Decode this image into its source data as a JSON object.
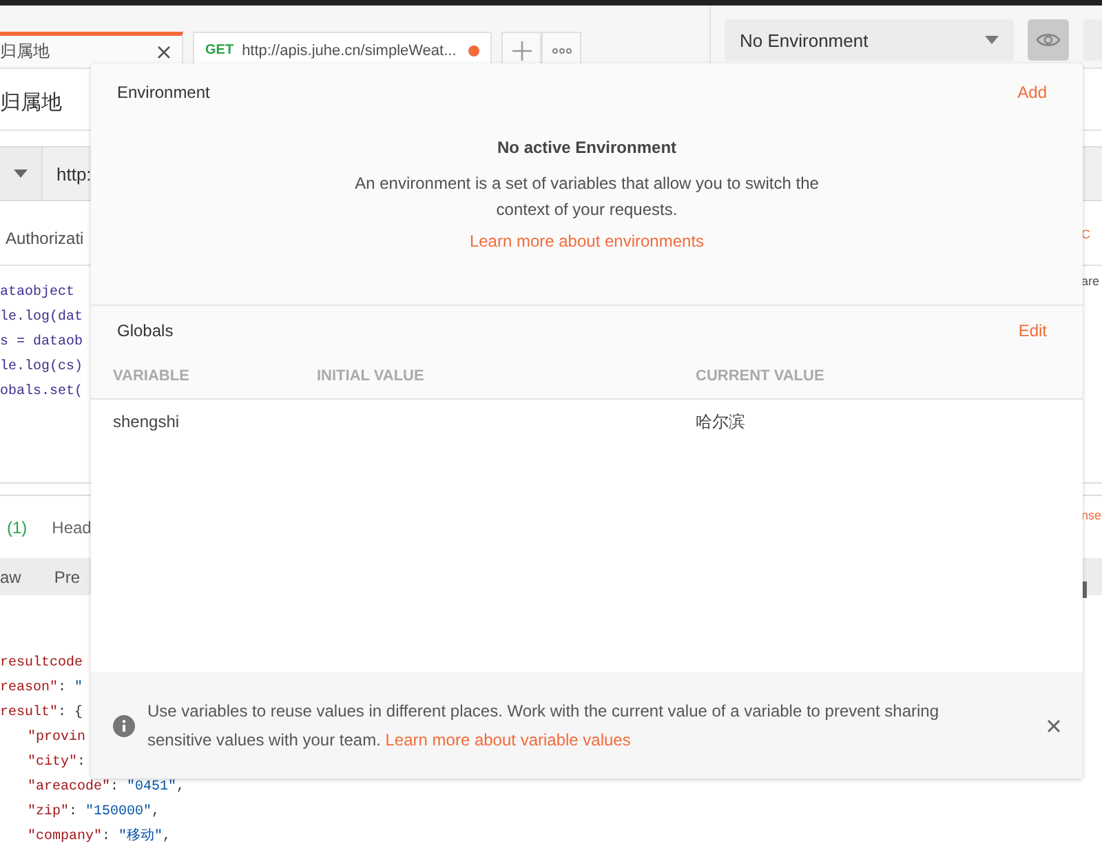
{
  "tabs": [
    {
      "title": "归属地",
      "selected": true,
      "unsaved": false
    },
    {
      "method": "GET",
      "title": "http://apis.juhe.cn/simpleWeat...",
      "selected": false,
      "unsaved": true
    }
  ],
  "environment_selector": {
    "value": "No Environment"
  },
  "request": {
    "title": "归属地",
    "url": "http:"
  },
  "request_tabs": [
    {
      "label": "Authorizati"
    }
  ],
  "script_lines": [
    "ataobject",
    "le.log(dat",
    "s = dataob",
    "le.log(cs)",
    "obals.set("
  ],
  "response_tabs": [
    {
      "label": "(1)",
      "kind": "count"
    },
    {
      "label": "Head",
      "kind": "tab"
    }
  ],
  "body_modes": [
    "aw",
    "Pre"
  ],
  "response_lines": [
    {
      "parts": [
        {
          "kind": "key",
          "text": "resultcode"
        }
      ]
    },
    {
      "parts": [
        {
          "kind": "key",
          "text": "reason\""
        },
        {
          "kind": "punct",
          "text": ": "
        },
        {
          "kind": "string",
          "text": "\""
        }
      ]
    },
    {
      "parts": [
        {
          "kind": "key",
          "text": "result\""
        },
        {
          "kind": "punct",
          "text": ": {"
        }
      ],
      "children": [
        {
          "parts": [
            {
              "kind": "key",
              "text": "\"provin"
            }
          ]
        },
        {
          "parts": [
            {
              "kind": "key",
              "text": "\"city\""
            },
            {
              "kind": "punct",
              "text": ":"
            }
          ]
        },
        {
          "parts": [
            {
              "kind": "key",
              "text": "\"areacode\""
            },
            {
              "kind": "punct",
              "text": ": "
            },
            {
              "kind": "string",
              "text": "\"0451\""
            },
            {
              "kind": "punct",
              "text": ","
            }
          ]
        },
        {
          "parts": [
            {
              "kind": "key",
              "text": "\"zip\""
            },
            {
              "kind": "punct",
              "text": ": "
            },
            {
              "kind": "string",
              "text": "\"150000\""
            },
            {
              "kind": "punct",
              "text": ","
            }
          ]
        },
        {
          "parts": [
            {
              "kind": "key",
              "text": "\"company\""
            },
            {
              "kind": "punct",
              "text": ": "
            },
            {
              "kind": "string",
              "text": "\"移动\""
            },
            {
              "kind": "punct",
              "text": ","
            }
          ]
        }
      ]
    }
  ],
  "side_fragments": [
    {
      "text": "C",
      "kind": "link"
    },
    {
      "text": "are",
      "kind": "plain"
    },
    {
      "text": "nse",
      "kind": "link"
    }
  ],
  "popover": {
    "title": "Environment",
    "add_link": "Add",
    "empty_title": "No active Environment",
    "empty_text": "An environment is a set of variables that allow you to switch the context of your requests.",
    "empty_link": "Learn more about environments",
    "globals_title": "Globals",
    "edit_link": "Edit",
    "columns": [
      "VARIABLE",
      "INITIAL VALUE",
      "CURRENT VALUE"
    ],
    "rows": [
      [
        "shengshi",
        "",
        "哈尔滨"
      ]
    ],
    "tip_text": "Use variables to reuse values in different places. Work with the current value of a variable to prevent sharing sensitive values with your team.",
    "tip_link": "Learn more about variable values"
  }
}
